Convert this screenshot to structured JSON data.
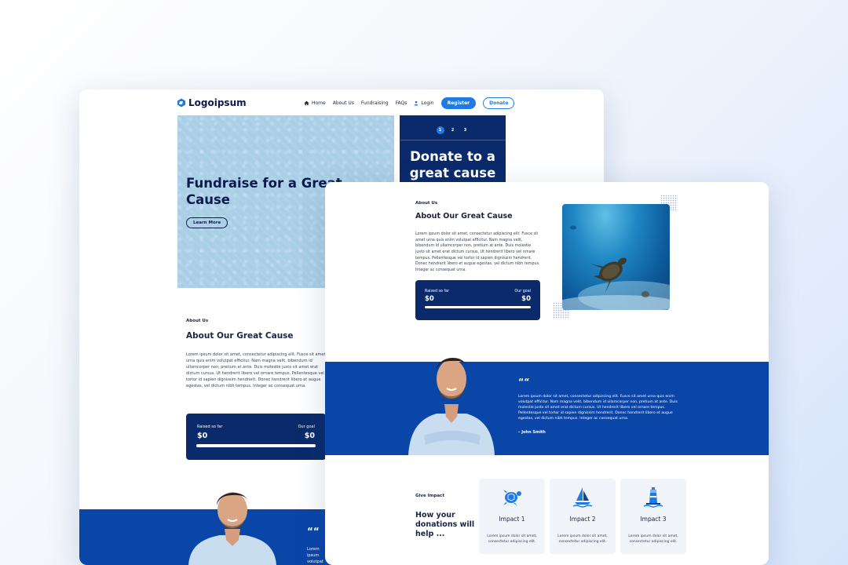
{
  "colors": {
    "navy": "#0a2a6b",
    "blue_band": "#0a45a8",
    "accent": "#1e7be6",
    "hero_light": "#a9cfe6"
  },
  "nav": {
    "logo": "Logoipsum",
    "links": [
      {
        "label": "Home",
        "icon": "home-icon"
      },
      {
        "label": "About Us"
      },
      {
        "label": "Fundraising"
      },
      {
        "label": "FAQs"
      },
      {
        "label": "Login",
        "icon": "user-icon"
      }
    ],
    "register": "Register",
    "donate": "Donate"
  },
  "hero": {
    "title": "Fundraise for a Great Cause",
    "learn_more": "Learn More",
    "slider_dots": [
      "1",
      "2",
      "3"
    ],
    "active_dot": 0,
    "side_title": "Donate to a great cause"
  },
  "about": {
    "eyebrow": "About Us",
    "heading": "About Our Great Cause",
    "body": "Lorem ipsum dolor sit amet, consectetur adipiscing elit. Fusce sit amet urna quis enim volutpat efficitur. Nam magna velit, bibendum id ullamcorper non, pretium at ante. Duis molestie justo sit amet erat dictum cursus. Ut hendrerit libero vel ornare tempus. Pellentesque vel tortor id sapien dignissim hendrerit. Donec hendrerit libero et augue egestas, vel dictum nibh tempus. Integer ac consequat urna."
  },
  "raised": {
    "raised_label": "Raised so far",
    "raised_value": "$0",
    "goal_label": "Our goal",
    "goal_value": "$0",
    "progress": 0
  },
  "testimonial": {
    "quote_mark": "““",
    "text": "Lorem ipsum dolor sit amet, consectetur adipiscing elit. Fusce sit amet urna quis enim volutpat efficitur. Nam magna velit, bibendum id ullamcorper non, pretium at ante. Duis molestie justo sit amet erat dictum cursus. Ut hendrerit libero vel ornare tempus. Pellentesque vel tortor id sapien dignissim hendrerit. Donec hendrerit libero et augue egestas, vel dictum nibh tempus. Integer ac consequat urna.",
    "back_text": "Lorem ipsum volutpat",
    "author": "– John Smith"
  },
  "impact": {
    "eyebrow": "Give Impact",
    "heading": "How your donations will help ...",
    "cards": [
      {
        "title": "Impact 1",
        "icon": "turtle-icon",
        "desc": "Lorem ipsum dolor sit amet, consectetur adipiscing elit."
      },
      {
        "title": "Impact 2",
        "icon": "sailboat-icon",
        "desc": "Lorem ipsum dolor sit amet, consectetur adipiscing elit."
      },
      {
        "title": "Impact 3",
        "icon": "lighthouse-icon",
        "desc": "Lorem ipsum dolor sit amet, consectetur adipiscing elit."
      }
    ]
  }
}
